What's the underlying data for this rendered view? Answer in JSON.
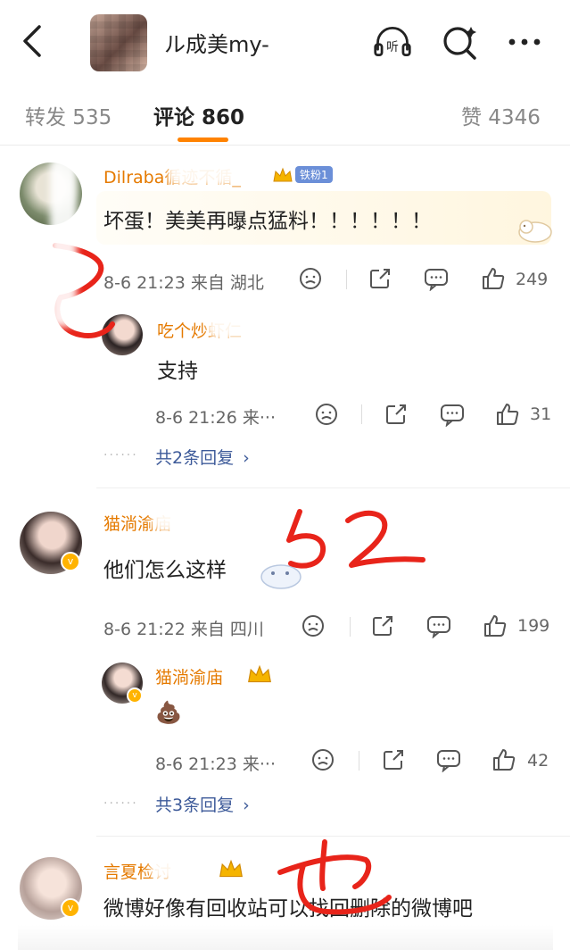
{
  "header": {
    "username": "ル成美my-",
    "listen_label": "听"
  },
  "tabs": [
    {
      "label": "转发 535"
    },
    {
      "label": "评论 860"
    },
    {
      "label": "赞 4346"
    }
  ],
  "comments": [
    {
      "name": "Dilraba循迹不循_",
      "fan_badge": "铁粉1",
      "text": "坏蛋！美美再曝点猛料！！！！！！",
      "time": "8-6 21:23  来自 湖北",
      "likes": "249",
      "reply": {
        "name": "吃个炒虾仁",
        "text": "支持",
        "time": "8-6 21:26  来···",
        "likes": "31"
      },
      "more_replies": "共2条回复"
    },
    {
      "name": "猫淌渝庙",
      "text": "他们怎么这样",
      "time": "8-6 21:22  来自 四川",
      "likes": "199",
      "reply": {
        "name": "猫淌渝庙",
        "text": "💩",
        "time": "8-6 21:23  来···",
        "likes": "42"
      },
      "more_replies": "共3条回复"
    },
    {
      "name": "言夏检讨",
      "text": "微博好像有回收站可以找回删除的微博吧"
    }
  ],
  "annotations": {
    "mark_1": "巳",
    "mark_2": "52",
    "mark_3": "也"
  },
  "colors": {
    "accent": "#ff8200",
    "username": "#e57a00",
    "link": "#3d5a99",
    "annotation": "#e8241a"
  }
}
